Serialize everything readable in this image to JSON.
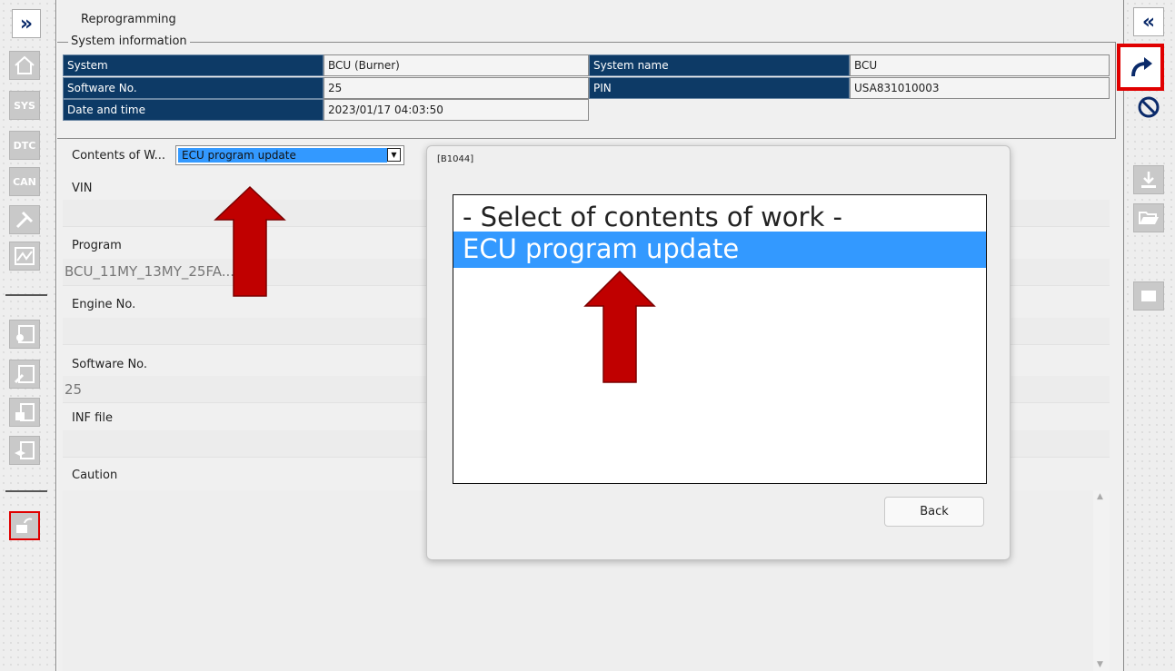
{
  "page": {
    "title": "Reprogramming"
  },
  "left_toolbar": {
    "expand_icon": "double-chevron-right-icon",
    "items": [
      {
        "icon": "home-icon",
        "label": ""
      },
      {
        "icon": "sys-icon",
        "label": "SYS"
      },
      {
        "icon": "dtc-icon",
        "label": "DTC"
      },
      {
        "icon": "can-icon",
        "label": "CAN"
      },
      {
        "icon": "tools-icon",
        "label": ""
      },
      {
        "icon": "data-monitor-icon",
        "label": ""
      },
      {
        "icon": "settings-list-icon",
        "label": ""
      },
      {
        "icon": "edit-list-icon",
        "label": ""
      },
      {
        "icon": "lock-list-icon",
        "label": ""
      },
      {
        "icon": "training-list-icon",
        "label": ""
      },
      {
        "icon": "reprogram-chip-icon",
        "label": ""
      }
    ]
  },
  "right_toolbar": {
    "collapse_icon": "double-chevron-left-icon",
    "items": [
      {
        "icon": "proceed-arrow-icon"
      },
      {
        "icon": "cancel-icon"
      },
      {
        "icon": "download-icon"
      },
      {
        "icon": "open-folder-icon"
      },
      {
        "icon": "chip-icon"
      }
    ]
  },
  "system_information": {
    "legend": "System information",
    "rows": [
      {
        "label1": "System",
        "value1": "BCU (Burner)",
        "label2": "System name",
        "value2": "BCU"
      },
      {
        "label1": "Software No.",
        "value1": "25",
        "label2": "PIN",
        "value2": "USA831010003"
      },
      {
        "label1": "Date and time",
        "value1": "2023/01/17 04:03:50"
      }
    ]
  },
  "contents_of_work": {
    "label": "Contents of W...",
    "selected": "ECU program update"
  },
  "fields": {
    "vin": {
      "label": "VIN",
      "value": ""
    },
    "program": {
      "label": "Program",
      "value": "BCU_11MY_13MY_25FA..."
    },
    "engine_no": {
      "label": "Engine No.",
      "value": ""
    },
    "software_no": {
      "label": "Software No.",
      "value": "25"
    },
    "inf_file": {
      "label": "INF file",
      "value": ""
    },
    "caution": {
      "label": "Caution",
      "value": ""
    }
  },
  "dialog": {
    "title": "[B1044]",
    "options": [
      "- Select of contents of work -",
      "ECU program update"
    ],
    "selected_index": 1,
    "back_label": "Back"
  },
  "colors": {
    "header_blue": "#0d3a66",
    "selection_blue": "#3399ff",
    "highlight_red": "#e00000",
    "arrow_red": "#c00000"
  }
}
